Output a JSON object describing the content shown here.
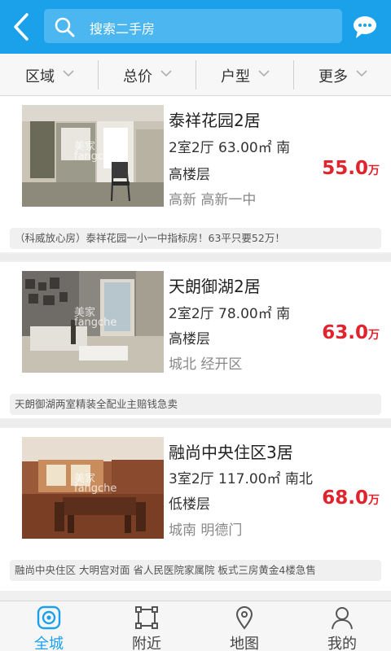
{
  "header": {
    "back_icon": "chevron-left-icon",
    "search_placeholder": "搜索二手房",
    "message_icon": "chat-bubble-icon",
    "accent_color": "#1ba1ea"
  },
  "filters": [
    {
      "label": "区域"
    },
    {
      "label": "总价"
    },
    {
      "label": "户型"
    },
    {
      "label": "更多"
    }
  ],
  "watermark": "美家\nfangche",
  "listings": [
    {
      "title": "泰祥花园2居",
      "spec": "2室2厅 63.00㎡ 南",
      "floor": "高楼层",
      "price": "55.0",
      "unit": "万",
      "area": "高新 高新一中",
      "desc": "（科威放心房）泰祥花园一小一中指标房！63平只要52万！"
    },
    {
      "title": "天朗御湖2居",
      "spec": "2室2厅 78.00㎡ 南",
      "floor": "高楼层",
      "price": "63.0",
      "unit": "万",
      "area": "城北 经开区",
      "desc": "天朗御湖两室精装全配业主赔钱急卖"
    },
    {
      "title": "融尚中央住区3居",
      "spec": "3室2厅 117.00㎡ 南北",
      "floor": "低楼层",
      "price": "68.0",
      "unit": "万",
      "area": "城南 明德门",
      "desc": "融尚中央住区 大明宫对面 省人民医院家属院 板式三房黄金4楼急售"
    }
  ],
  "tabs": [
    {
      "label": "全城",
      "icon": "target-icon",
      "active": true
    },
    {
      "label": "附近",
      "icon": "nearby-frame-icon",
      "active": false
    },
    {
      "label": "地图",
      "icon": "map-pin-icon",
      "active": false
    },
    {
      "label": "我的",
      "icon": "user-icon",
      "active": false
    }
  ]
}
